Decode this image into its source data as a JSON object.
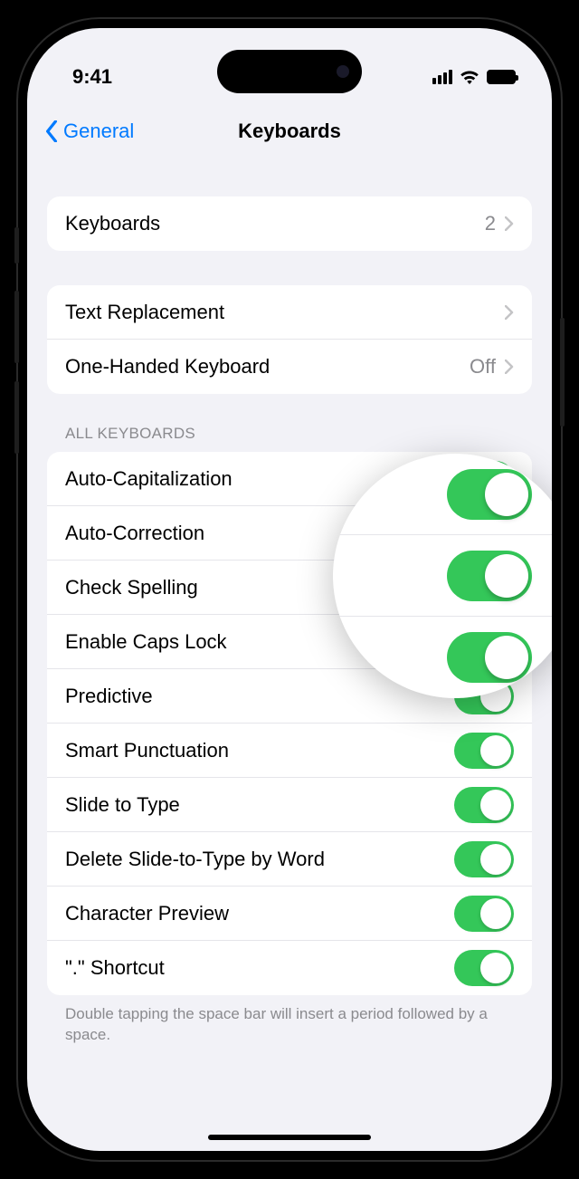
{
  "statusBar": {
    "time": "9:41"
  },
  "nav": {
    "back": "General",
    "title": "Keyboards"
  },
  "group1": {
    "keyboards": {
      "label": "Keyboards",
      "value": "2"
    }
  },
  "group2": {
    "textReplacement": {
      "label": "Text Replacement"
    },
    "oneHanded": {
      "label": "One-Handed Keyboard",
      "value": "Off"
    }
  },
  "sectionHeader": "ALL KEYBOARDS",
  "toggles": [
    {
      "label": "Auto-Capitalization",
      "on": true
    },
    {
      "label": "Auto-Correction",
      "on": true
    },
    {
      "label": "Check Spelling",
      "on": true
    },
    {
      "label": "Enable Caps Lock",
      "on": true
    },
    {
      "label": "Predictive",
      "on": true
    },
    {
      "label": "Smart Punctuation",
      "on": true
    },
    {
      "label": "Slide to Type",
      "on": true
    },
    {
      "label": "Delete Slide-to-Type by Word",
      "on": true
    },
    {
      "label": "Character Preview",
      "on": true
    },
    {
      "label": "\".\" Shortcut",
      "on": true
    }
  ],
  "footer": "Double tapping the space bar will insert a period followed by a space."
}
